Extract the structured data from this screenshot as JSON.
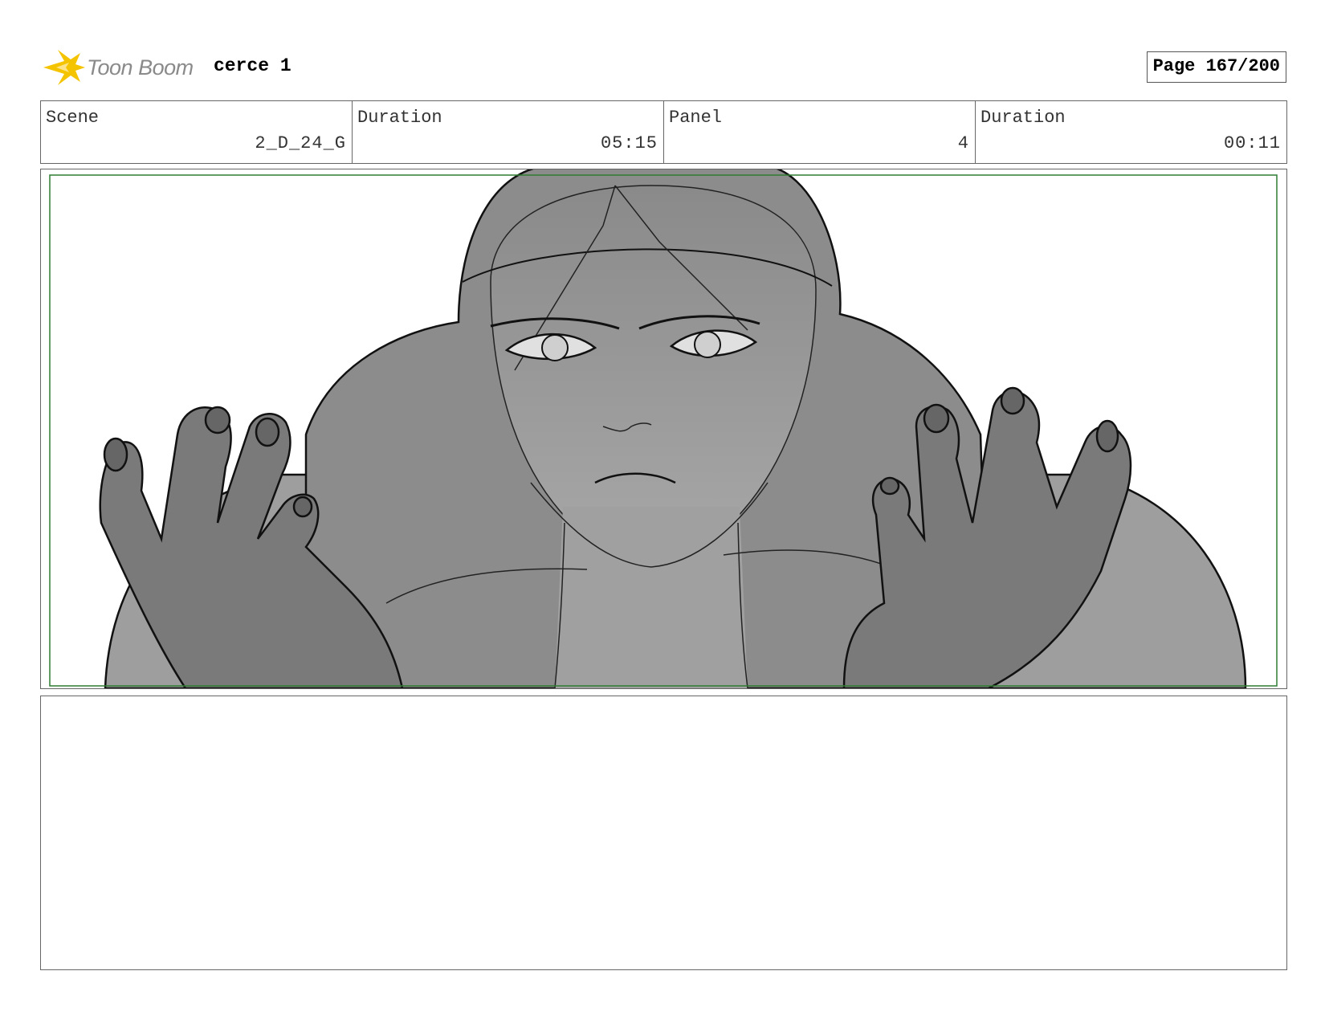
{
  "header": {
    "logo_text": "Toon Boom",
    "project_title": "cerce 1",
    "page_label": "Page 167/200"
  },
  "info": [
    {
      "label": "Scene",
      "value": "2_D_24_G"
    },
    {
      "label": "Duration",
      "value": "05:15"
    },
    {
      "label": "Panel",
      "value": "4"
    },
    {
      "label": "Duration",
      "value": "00:11"
    }
  ],
  "panel": {
    "description": "",
    "safe_frame_color": "#2e7d32"
  },
  "notes": {
    "text": ""
  },
  "colors": {
    "logo_yellow": "#f5c400",
    "border": "#666666"
  }
}
